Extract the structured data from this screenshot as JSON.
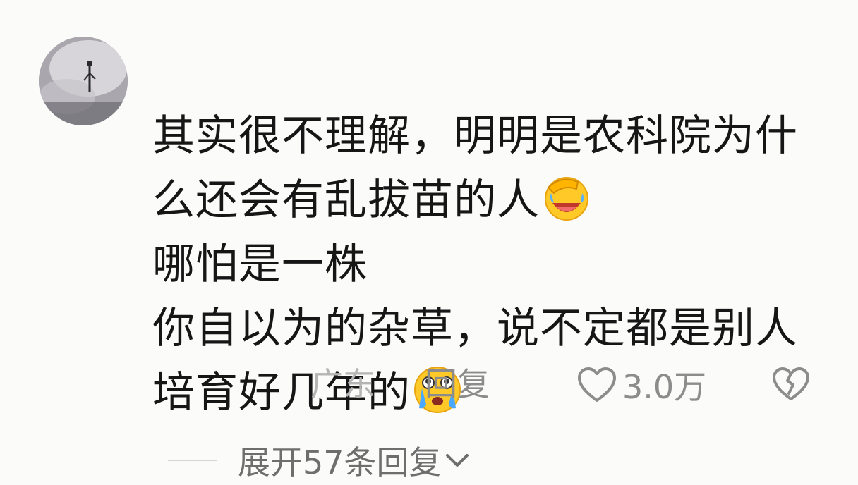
{
  "comment": {
    "avatar_alt": "",
    "lines": [
      "其实很不理解，明明是农科院为什",
      "么还会有乱拔苗的人",
      "哪怕是一株",
      "你自以为的杂草，说不定都是别人",
      "培育好几年的"
    ],
    "emoji_1": "facepalm-laugh-emoji",
    "emoji_2": "crying-emoji"
  },
  "meta": {
    "location": "广东",
    "reply_label": "回复",
    "like_count": "3.0万",
    "like_icon": "heart-outline-icon",
    "dislike_icon": "broken-heart-icon"
  },
  "replies": {
    "expand_label": "展开57条回复",
    "chevron_icon": "chevron-down-icon"
  },
  "colors": {
    "background": "#fbfbf9",
    "text": "#161616",
    "muted": "#8c8c8c",
    "location": "#b5b5b5"
  }
}
